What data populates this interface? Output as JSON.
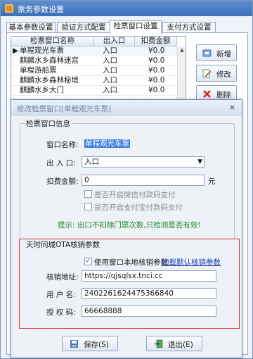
{
  "window": {
    "title": "票务参数设置"
  },
  "tabs": [
    {
      "label": "基本参数设置"
    },
    {
      "label": "验证方式配置"
    },
    {
      "label": "检票窗口设置"
    },
    {
      "label": "支付方式设置"
    }
  ],
  "grid": {
    "headers": [
      "检票窗口名称",
      "出入口",
      "扣费金额"
    ],
    "rows": [
      {
        "name": "单程观光车票",
        "gate": "入口",
        "fee": "¥0.0"
      },
      {
        "name": "麒麟水乡森林迷宫",
        "gate": "入口",
        "fee": "¥0.0"
      },
      {
        "name": "单程游船票",
        "gate": "入口",
        "fee": "¥0.0"
      },
      {
        "name": "麒麟水乡森林秘境",
        "gate": "入口",
        "fee": "¥0.0"
      },
      {
        "name": "麒麟水乡大门",
        "gate": "入口",
        "fee": "¥0.0"
      }
    ],
    "selected_marker": "▶"
  },
  "side_buttons": {
    "add": "新增",
    "edit": "修改",
    "delete": "删除"
  },
  "dialog": {
    "title": "修改检票窗口[单程观光车票]",
    "close": "×",
    "group1": {
      "legend": "检票窗口信息",
      "name_label": "窗口名称:",
      "name_value": "单程观光车票",
      "gate_label": "出 入 口:",
      "gate_value": "入口",
      "fee_label": "扣费金额:",
      "fee_value": "0",
      "fee_unit": "元",
      "wechat_label": "是否开启微信付款码支付",
      "alipay_label": "是否开启支付宝付款码支付",
      "hint": "提示: 出口不扣除门票次数,只检测是否有效!"
    },
    "group2": {
      "legend": "天时同城OTA核销参数",
      "use_local_label": "使用窗口本地核销参数",
      "load_default_link": "加载默认核销参数",
      "url_label": "核销地址:",
      "url_value": "https://qjsqlsx.tnci.cc",
      "user_label": "用 户 名:",
      "user_value": "2402261624475366840",
      "auth_label": "授 权 码:",
      "auth_value": "66668888"
    },
    "save": "保存(S)",
    "exit": "退出(E)"
  },
  "colors": {
    "accent": "#3b6fb6",
    "hint": "#1a8a2a",
    "link": "#1a3fb0",
    "highlight": "#d83a3a"
  }
}
